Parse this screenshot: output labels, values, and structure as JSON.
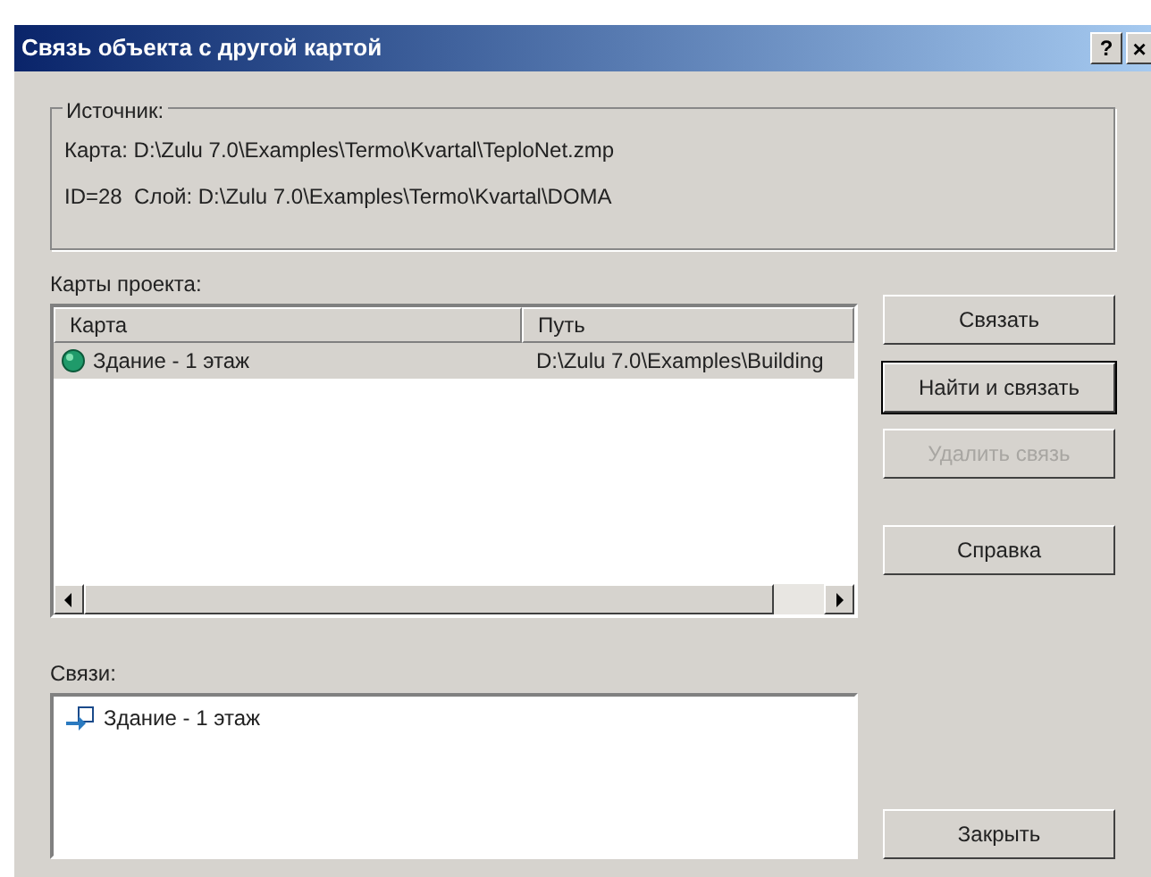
{
  "window": {
    "title": "Связь объекта с другой картой",
    "help": "?",
    "close": "×"
  },
  "source": {
    "legend": "Источник:",
    "lines": [
      "Карта: D:\\Zulu 7.0\\Examples\\Termo\\Kvartal\\TeploNet.zmp",
      "ID=28  Слой: D:\\Zulu 7.0\\Examples\\Termo\\Kvartal\\DOMA"
    ]
  },
  "project_maps": {
    "label": "Карты проекта:",
    "columns": [
      "Карта",
      "Путь"
    ],
    "rows": [
      {
        "map": "Здание - 1 этаж",
        "path": "D:\\Zulu 7.0\\Examples\\Building",
        "selected": true
      }
    ]
  },
  "links": {
    "label": "Связи:",
    "items": [
      "Здание - 1 этаж"
    ]
  },
  "buttons": [
    {
      "label": "Связать",
      "disabled": false,
      "focused": false
    },
    {
      "label": "Найти и связать",
      "disabled": false,
      "focused": true
    },
    {
      "label": "Удалить связь",
      "disabled": true,
      "focused": false
    },
    {
      "label": "Справка",
      "disabled": false,
      "focused": false
    },
    {
      "label": "Закрыть",
      "disabled": false,
      "focused": false
    }
  ]
}
